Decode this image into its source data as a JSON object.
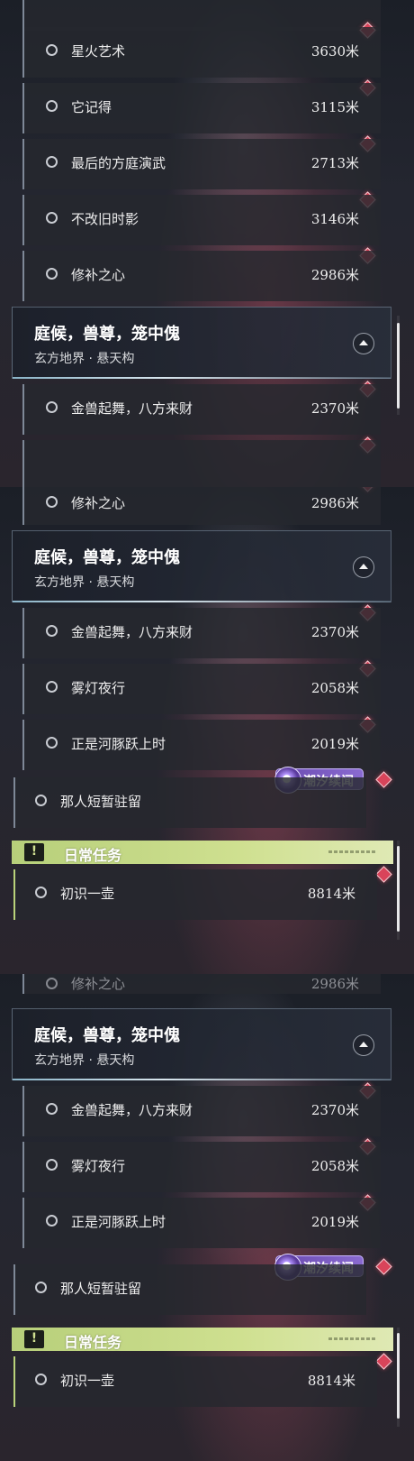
{
  "group": {
    "title": "庭候，兽尊，笼中傀",
    "subtitle": "玄方地界 · 悬天构"
  },
  "quests": {
    "xinghuo": {
      "name": "星火艺术",
      "distance": "3630米"
    },
    "taji": {
      "name": "它记得",
      "distance": "3115米"
    },
    "fangting": {
      "name": "最后的方庭演武",
      "distance": "2713米"
    },
    "bugai": {
      "name": "不改旧时影",
      "distance": "3146米"
    },
    "xiubu": {
      "name": "修补之心",
      "distance": "2986米"
    },
    "jinshou": {
      "name": "金兽起舞，八方来财",
      "distance": "2370米"
    },
    "wudeng": {
      "name": "雾灯夜行",
      "distance": "2058米"
    },
    "hetun": {
      "name": "正是河豚跃上时",
      "distance": "2019米"
    },
    "naren": {
      "name": "那人短暂驻留"
    },
    "chushi": {
      "name": "初识一壶",
      "distance": "8814米"
    }
  },
  "event_badge": {
    "label": "潮汐续闻"
  },
  "daily": {
    "label": "日常任务",
    "icon": "exclamation-icon"
  },
  "icons": {
    "quest_status": "circle-icon",
    "tracker": "diamond-marker-icon",
    "collapse": "chevron-up-icon"
  },
  "colors": {
    "marker": "#d9445a",
    "daily_accent": "#b9d37a",
    "event_accent": "#7a58c4"
  }
}
